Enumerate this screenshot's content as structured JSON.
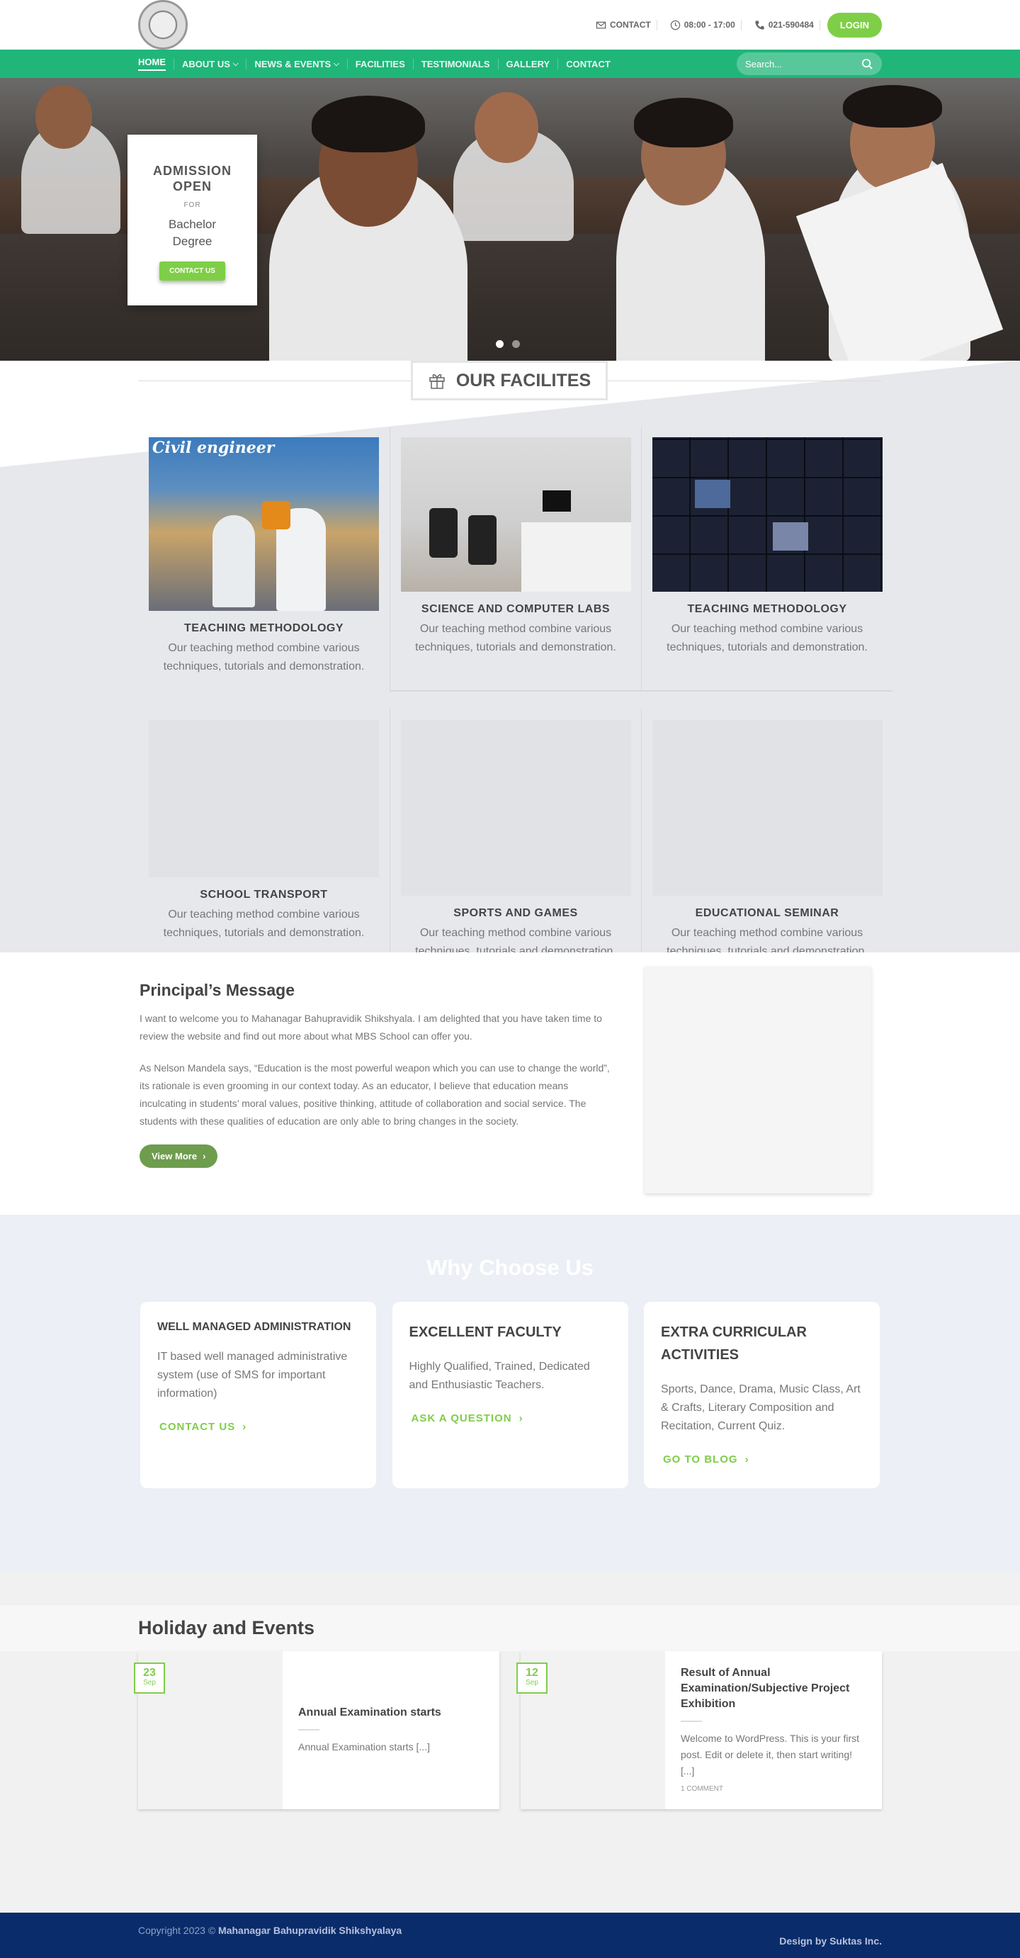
{
  "header": {
    "contact_label": "CONTACT",
    "hours": "08:00 - 17:00",
    "phone": "021-590484",
    "login_label": "LOGIN"
  },
  "nav": {
    "items": [
      {
        "label": "HOME",
        "has_dropdown": false
      },
      {
        "label": "ABOUT US",
        "has_dropdown": true
      },
      {
        "label": "NEWS & EVENTS",
        "has_dropdown": true
      },
      {
        "label": "FACILITIES",
        "has_dropdown": false
      },
      {
        "label": "TESTIMONIALS",
        "has_dropdown": false
      },
      {
        "label": "GALLERY",
        "has_dropdown": false
      },
      {
        "label": "CONTACT",
        "has_dropdown": false
      }
    ],
    "search_placeholder": "Search..."
  },
  "hero": {
    "title_line1": "ADMISSION",
    "title_line2": "OPEN",
    "for_label": "FOR",
    "degree_line1": "Bachelor",
    "degree_line2": "Degree",
    "button_label": "CONTACT US"
  },
  "facilities": {
    "heading": "OUR FACILITES",
    "items": [
      {
        "title": "TEACHING METHODOLOGY",
        "text": "Our teaching method combine various techniques, tutorials and demonstration.",
        "image_caption": "Civil engineer"
      },
      {
        "title": "SCIENCE AND COMPUTER LABS",
        "text": "Our teaching method combine various techniques, tutorials and demonstration."
      },
      {
        "title": "TEACHING METHODOLOGY",
        "text": "Our teaching method combine various techniques, tutorials and demonstration."
      },
      {
        "title": "SCHOOL TRANSPORT",
        "text": "Our teaching method combine various techniques, tutorials and demonstration."
      },
      {
        "title": "SPORTS AND GAMES",
        "text": "Our teaching method combine various techniques, tutorials and demonstration."
      },
      {
        "title": "EDUCATIONAL SEMINAR",
        "text": "Our teaching method combine various techniques, tutorials and demonstration."
      }
    ]
  },
  "principal": {
    "title": "Principal’s Message",
    "para1": "I want to welcome you to Mahanagar Bahupravidik Shikshyala. I am delighted that you have taken time to review the website and find out more about what MBS School can offer you.",
    "para2": "As Nelson Mandela says, “Education is the most powerful weapon which you can use to change the world”, its rationale is even grooming in our context today. As an educator, I believe that education means inculcating in students’ moral values, positive thinking, attitude of collaboration and social service. The students with these qualities of education are only able to bring changes in the society.",
    "button_label": "View More"
  },
  "why": {
    "title": "Why Choose Us",
    "cards": [
      {
        "title": "WELL MANAGED ADMINISTRATION",
        "text": "IT based well managed administrative system (use of SMS for important information)",
        "link": "CONTACT US"
      },
      {
        "title": "EXCELLENT FACULTY",
        "text": "Highly Qualified, Trained, Dedicated and Enthusiastic Teachers.",
        "link": "ASK A QUESTION"
      },
      {
        "title": "EXTRA CURRICULAR ACTIVITIES",
        "text": "Sports, Dance, Drama, Music Class, Art & Crafts, Literary Composition and Recitation, Current Quiz.",
        "link": "GO TO BLOG"
      }
    ]
  },
  "events": {
    "title": "Holiday and Events",
    "items": [
      {
        "day": "23",
        "month": "Sep",
        "title": "Annual Examination starts",
        "excerpt": "Annual Examination starts [...]",
        "comments": ""
      },
      {
        "day": "12",
        "month": "Sep",
        "title": "Result of Annual Examination/Subjective Project Exhibition",
        "excerpt": "Welcome to WordPress. This is your first post. Edit or delete it, then start writing! [...]",
        "comments": "1 COMMENT"
      }
    ]
  },
  "footer": {
    "copyright": "Copyright 2023 ©",
    "school_name": "Mahanagar Bahupravidik Shikshyalaya",
    "credit": "Design by Suktas Inc."
  },
  "colors": {
    "brand_green": "#20b67a",
    "accent_green": "#7fce47",
    "footer_blue": "#0b2c6b"
  }
}
